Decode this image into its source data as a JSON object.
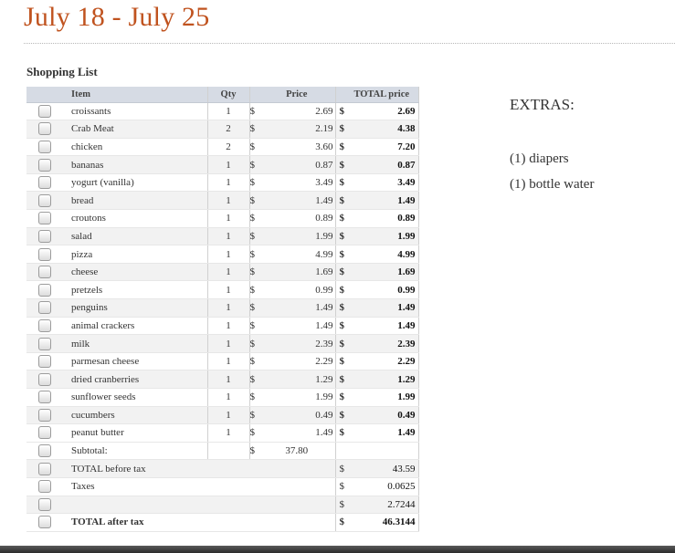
{
  "title": "July 18 - July 25",
  "section_title": "Shopping List",
  "columns": {
    "item": "Item",
    "qty": "Qty",
    "price": "Price",
    "total": "TOTAL price"
  },
  "currency": "$",
  "items": [
    {
      "name": "croissants",
      "qty": "1",
      "price": "2.69",
      "total": "2.69"
    },
    {
      "name": "Crab Meat",
      "qty": "2",
      "price": "2.19",
      "total": "4.38"
    },
    {
      "name": "chicken",
      "qty": "2",
      "price": "3.60",
      "total": "7.20"
    },
    {
      "name": "bananas",
      "qty": "1",
      "price": "0.87",
      "total": "0.87"
    },
    {
      "name": "yogurt (vanilla)",
      "qty": "1",
      "price": "3.49",
      "total": "3.49"
    },
    {
      "name": "bread",
      "qty": "1",
      "price": "1.49",
      "total": "1.49"
    },
    {
      "name": "croutons",
      "qty": "1",
      "price": "0.89",
      "total": "0.89"
    },
    {
      "name": "salad",
      "qty": "1",
      "price": "1.99",
      "total": "1.99"
    },
    {
      "name": "pizza",
      "qty": "1",
      "price": "4.99",
      "total": "4.99"
    },
    {
      "name": "cheese",
      "qty": "1",
      "price": "1.69",
      "total": "1.69"
    },
    {
      "name": "pretzels",
      "qty": "1",
      "price": "0.99",
      "total": "0.99"
    },
    {
      "name": "penguins",
      "qty": "1",
      "price": "1.49",
      "total": "1.49"
    },
    {
      "name": "animal crackers",
      "qty": "1",
      "price": "1.49",
      "total": "1.49"
    },
    {
      "name": "milk",
      "qty": "1",
      "price": "2.39",
      "total": "2.39"
    },
    {
      "name": "parmesan cheese",
      "qty": "1",
      "price": "2.29",
      "total": "2.29"
    },
    {
      "name": "dried cranberries",
      "qty": "1",
      "price": "1.29",
      "total": "1.29"
    },
    {
      "name": "sunflower seeds",
      "qty": "1",
      "price": "1.99",
      "total": "1.99"
    },
    {
      "name": "cucumbers",
      "qty": "1",
      "price": "0.49",
      "total": "0.49"
    },
    {
      "name": "peanut butter",
      "qty": "1",
      "price": "1.49",
      "total": "1.49"
    }
  ],
  "summary": {
    "subtotal_label": "Subtotal:",
    "subtotal_value": "37.80",
    "before_tax_label": "TOTAL before tax",
    "before_tax_value": "43.59",
    "taxes_label": "Taxes",
    "tax_rate": "0.0625",
    "tax_amount": "2.7244",
    "after_tax_label": "TOTAL after tax",
    "after_tax_value": "46.3144"
  },
  "extras": {
    "heading": "EXTRAS:",
    "items": [
      "(1) diapers",
      "(1) bottle water"
    ]
  },
  "colors": {
    "title": "#c0531f",
    "header_bg": "#d6dbe4",
    "row_alt": "#f2f2f2"
  }
}
